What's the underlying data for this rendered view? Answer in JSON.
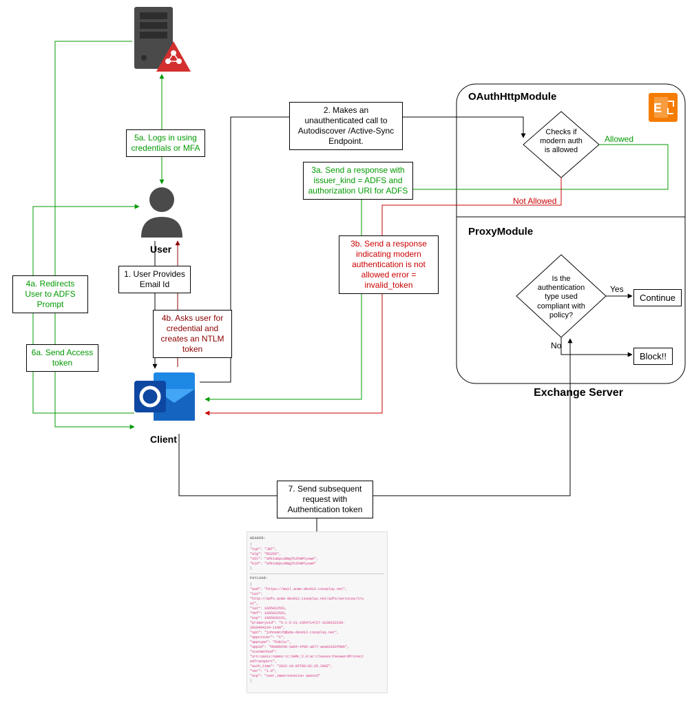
{
  "nodes": {
    "user": "User",
    "client": "Client",
    "exchange": "Exchange Server",
    "oauth_module": "OAuthHttpModule",
    "proxy_module": "ProxyModule"
  },
  "steps": {
    "s1": "1. User Provides Email Id",
    "s2": "2. Makes an unauthenticated call to Autodiscover /Active-Sync Endpoint.",
    "s3a": "3a. Send a response with issuer_kind = ADFS and authorization URI for ADFS",
    "s3b": "3b. Send a response indicating modern authentication is not allowed error = invalid_token",
    "s4a": "4a. Redirects User to ADFS Prompt",
    "s4b": "4b. Asks user for credential and creates an NTLM token",
    "s5a": "5a. Logs in using credentials or MFA",
    "s6a": "6a. Send Access token",
    "s7": "7. Send subsequent request with Authentication token"
  },
  "decisions": {
    "d1": "Checks if modern auth is allowed",
    "d1_yes": "Allowed",
    "d1_no": "Not Allowed",
    "d2": "Is the authentication type used compliant with policy?",
    "d2_yes": "Yes",
    "d2_no": "No"
  },
  "actions": {
    "continue": "Continue",
    "block": "Block!!"
  },
  "token_panel": {
    "header_label": "HEADER:",
    "payload_label": "PAYLOAD:",
    "header_lines": [
      "\"typ\": \"JWT\",",
      "\"alg\": \"RS256\",",
      "\"x5t\": \"sPEtabpczRmgTk2FmMlyvwA\",",
      "\"kid\": \"sPEtabpczRmgTk2FmMlyvwA\""
    ],
    "payload_lines": [
      "\"aud\": \"https://mail.acme-dev012.ciexplay.net\",",
      "\"iss\":",
      "\"http://adfs.acme-dev012.ciexplay.net/adfs/services/tru",
      "st\",",
      "\"iat\": 1665022551,",
      "\"nbf\": 1665022551,",
      "\"exp\": 1665026151,",
      "\"primarysid\": \"S-1-5-21-2364714727-3230152159-",
      "2018404234-1108\",",
      "\"upn\": \"johnsmith@ada-dev012-ciexplay.net\",",
      "\"appctxver\": \"1\",",
      "\"apptype\": \"Public\",",
      "\"appid\": \"bb08b540-3a04-4f85-a877-aea0181bf8bb\",",
      "\"scatmethod\":",
      "\"urn:oasis:names:tc:SAML:2.0:ac:classes:PasswordProtect",
      "edTransport\",",
      "\"auth_time\": \"2022-10-05T08:02:25.299Z\",",
      "\"ver\": \"1.0\",",
      "\"scp\": \"user_impersonation openid\""
    ]
  },
  "chart_data": {
    "type": "flowchart",
    "nodes": [
      {
        "id": "adfs_server",
        "label": "ADFS Server",
        "kind": "icon"
      },
      {
        "id": "user",
        "label": "User",
        "kind": "actor"
      },
      {
        "id": "client",
        "label": "Client (Outlook)",
        "kind": "actor"
      },
      {
        "id": "oauth_module",
        "label": "OAuthHttpModule",
        "kind": "module"
      },
      {
        "id": "proxy_module",
        "label": "ProxyModule",
        "kind": "module"
      },
      {
        "id": "d1",
        "label": "Checks if modern auth is allowed",
        "kind": "decision"
      },
      {
        "id": "d2",
        "label": "Is the authentication type used compliant with policy?",
        "kind": "decision"
      },
      {
        "id": "continue",
        "label": "Continue",
        "kind": "terminal"
      },
      {
        "id": "block",
        "label": "Block!!",
        "kind": "terminal"
      },
      {
        "id": "token",
        "label": "JWT token detail",
        "kind": "data"
      }
    ],
    "edges": [
      {
        "from": "user",
        "to": "client",
        "label": "1. User Provides Email Id"
      },
      {
        "from": "client",
        "to": "oauth_module",
        "label": "2. Makes an unauthenticated call to Autodiscover /Active-Sync Endpoint."
      },
      {
        "from": "oauth_module",
        "to": "client",
        "label": "3a. Send a response with issuer_kind = ADFS and authorization URI for ADFS",
        "branch": "Allowed",
        "color": "green"
      },
      {
        "from": "oauth_module",
        "to": "client",
        "label": "3b. Send a response indicating modern authentication is not allowed error = invalid_token",
        "branch": "Not Allowed",
        "color": "red"
      },
      {
        "from": "client",
        "to": "user",
        "label": "4a. Redirects User to ADFS Prompt",
        "color": "green"
      },
      {
        "from": "client",
        "to": "user",
        "label": "4b. Asks user for credential and creates an NTLM token",
        "color": "darkred"
      },
      {
        "from": "user",
        "to": "adfs_server",
        "label": "5a. Logs in using credentials or MFA",
        "color": "green"
      },
      {
        "from": "adfs_server",
        "to": "client",
        "label": "6a. Send Access token",
        "color": "green"
      },
      {
        "from": "client",
        "to": "proxy_module",
        "label": "7. Send subsequent request with Authentication token"
      },
      {
        "from": "d2",
        "to": "continue",
        "label": "Yes"
      },
      {
        "from": "d2",
        "to": "block",
        "label": "No"
      }
    ]
  }
}
